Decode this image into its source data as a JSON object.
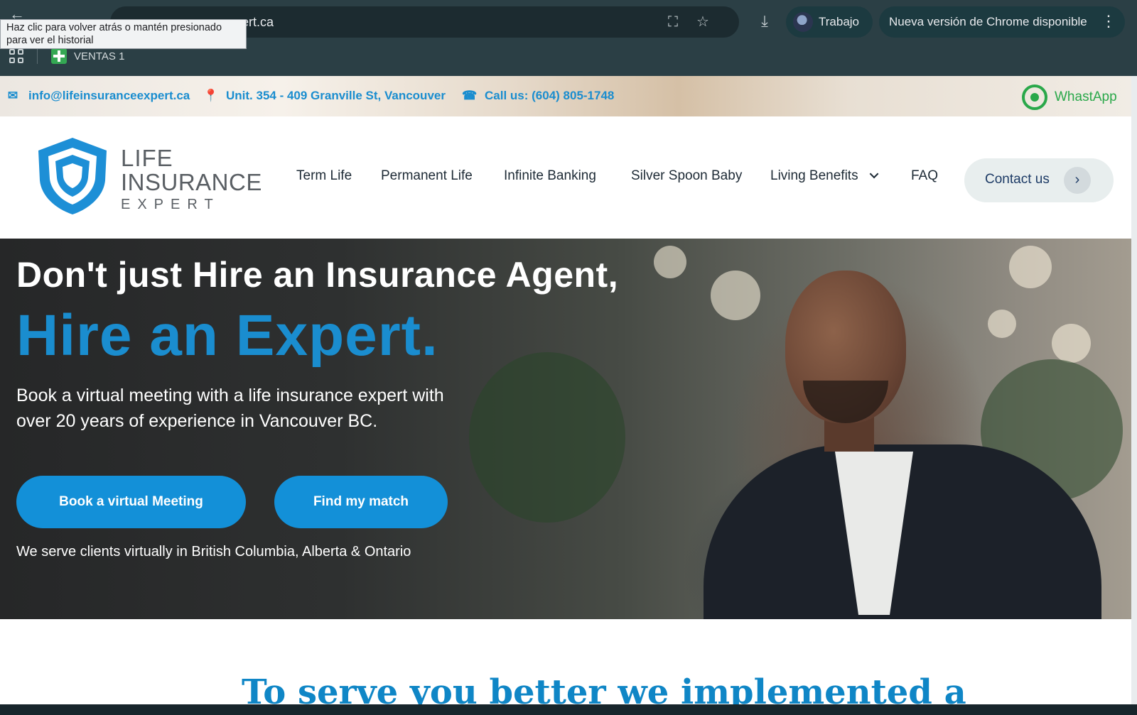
{
  "browser": {
    "url_fragment": "ert.ca",
    "profile_name": "Trabajo",
    "update_label": "Nueva versión de Chrome disponible",
    "bookmark_label": "VENTAS 1",
    "tooltip_line1": "Haz clic para volver atrás o mantén presionado",
    "tooltip_line2": "para ver el historial"
  },
  "topbar": {
    "email": "info@lifeinsuranceexpert.ca",
    "address": "Unit. 354 - 409 Granville St, Vancouver",
    "phone": "Call us: (604) 805-1748",
    "whatsapp": "WhastApp"
  },
  "logo": {
    "line1": "LIFE",
    "line2": "INSURANCE",
    "line3": "EXPERT"
  },
  "nav": {
    "items": [
      {
        "label": "Term Life"
      },
      {
        "label": "Permanent Life"
      },
      {
        "label": "Infinite Banking"
      },
      {
        "label": "Silver Spoon Baby"
      },
      {
        "label": "Living Benefits"
      },
      {
        "label": "FAQ"
      }
    ],
    "contact": "Contact us"
  },
  "hero": {
    "headline": "Don't just Hire an Insurance Agent,",
    "subheadline": "Hire an Expert.",
    "description": "Book a virtual meeting with a life insurance expert with over 20 years of experience in Vancouver BC.",
    "primary_button": "Book a virtual Meeting",
    "secondary_button": "Find my match",
    "note": "We serve clients virtually in British Columbia, Alberta & Ontario"
  },
  "section": {
    "title_partial": "To serve you better we implemented a"
  },
  "colors": {
    "brand_blue": "#1a8dcf",
    "button_blue": "#1390d8",
    "whatsapp_green": "#2aa84a",
    "chrome_frame": "#2b3f45"
  }
}
